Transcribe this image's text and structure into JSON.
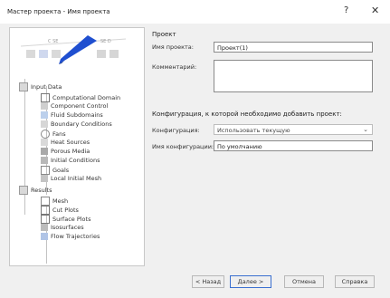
{
  "window": {
    "title": "Мастер проекта - Имя проекта",
    "help_label": "?",
    "close_label": "✕"
  },
  "diagram": {
    "label_fragments": [
      "C SE",
      "SE D"
    ]
  },
  "tree": {
    "items": [
      {
        "label": "Input Data",
        "level": 1,
        "icon": "folder-icon"
      },
      {
        "label": "Computational Domain",
        "level": 2,
        "icon": "domain-icon"
      },
      {
        "label": "Component Control",
        "level": 2,
        "icon": "component-icon"
      },
      {
        "label": "Fluid Subdomains",
        "level": 2,
        "icon": "fluid-icon"
      },
      {
        "label": "Boundary Conditions",
        "level": 2,
        "icon": "boundary-icon"
      },
      {
        "label": "Fans",
        "level": 2,
        "icon": "fan-icon"
      },
      {
        "label": "Heat Sources",
        "level": 2,
        "icon": "heat-icon"
      },
      {
        "label": "Porous Media",
        "level": 2,
        "icon": "porous-icon"
      },
      {
        "label": "Initial Conditions",
        "level": 2,
        "icon": "initial-icon"
      },
      {
        "label": "Goals",
        "level": 2,
        "icon": "goal-icon"
      },
      {
        "label": "Local Initial Mesh",
        "level": 2,
        "icon": "mesh-icon"
      },
      {
        "label": "Results",
        "level": 1,
        "icon": "results-icon"
      },
      {
        "label": "Mesh",
        "level": 2,
        "icon": "mesh-icon"
      },
      {
        "label": "Cut Plots",
        "level": 2,
        "icon": "cutplot-icon"
      },
      {
        "label": "Surface Plots",
        "level": 2,
        "icon": "surfaceplot-icon"
      },
      {
        "label": "Isosurfaces",
        "level": 2,
        "icon": "isosurface-icon"
      },
      {
        "label": "Flow Trajectories",
        "level": 2,
        "icon": "trajectory-icon"
      }
    ]
  },
  "form": {
    "section_project": "Проект",
    "name_label": "Имя проекта:",
    "name_value": "Проект(1)",
    "comment_label": "Комментарий:",
    "comment_value": "",
    "config_section": "Конфигурация, к которой необходимо добавить проект:",
    "config_label": "Конфигурация:",
    "config_value": "Использовать текущую",
    "config_name_label": "Имя конфигурации:",
    "config_name_value": "По умолчанию"
  },
  "footer": {
    "back": "< Назад",
    "next": "Далее >",
    "cancel": "Отмена",
    "help": "Справка"
  },
  "colors": {
    "accent_blue": "#1f4fd0",
    "primary_border": "#3a6fd0"
  }
}
